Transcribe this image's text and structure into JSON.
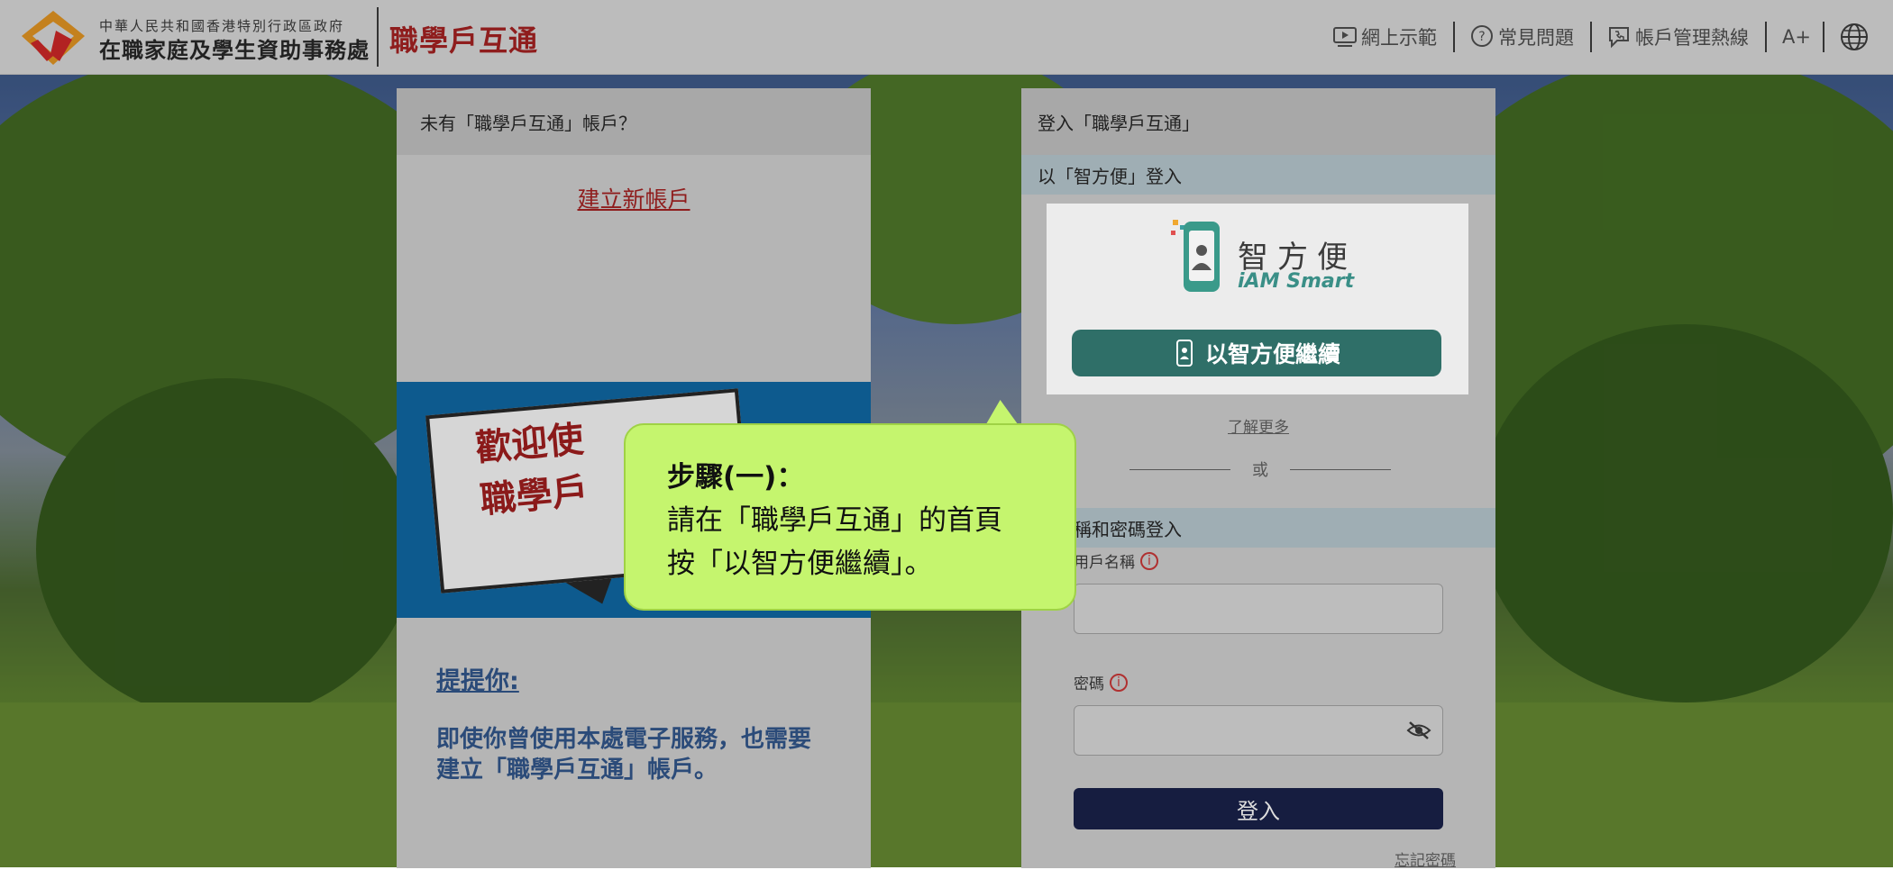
{
  "header": {
    "dept_small": "中華人民共和國香港特別行政區政府",
    "dept_name": "在職家庭及學生資助事務處",
    "portal_title": "職學戶互通",
    "nav": {
      "demo": "網上示範",
      "faq": "常見問題",
      "hotline": "帳戶管理熱線",
      "font_size": "A+"
    }
  },
  "left_panel": {
    "heading": "未有「職學戶互通」帳戶？",
    "create_link": "建立新帳戶",
    "banner_line1": "歡迎使",
    "banner_line2": "職學戶",
    "reminder_title": "提提你:",
    "reminder_body": "即使你曾使用本處電子服務，也需要建立「職學戶互通」帳戶。"
  },
  "right_panel": {
    "heading": "登入「職學戶互通」",
    "iam_section": "以「智方便」登入",
    "iam_name_cn": "智方便",
    "iam_name_en": "iAM Smart",
    "iam_button": "以智方便繼續",
    "learn_more": "了解更多",
    "or": "或",
    "pw_section": "戶名稱和密碼登入",
    "username_label": "用戶名稱",
    "password_label": "密碼",
    "login_button": "登入",
    "forgot": "忘記密碼"
  },
  "tooltip": {
    "title": "步驟(一)：",
    "line1": "請在「職學戶互通」的首頁",
    "line2": "按「以智方便繼續」。"
  },
  "colors": {
    "brand_red": "#8f1d1d",
    "iam_green": "#2f6f68",
    "login_navy": "#161d40",
    "tooltip_green": "#c5f56e"
  }
}
